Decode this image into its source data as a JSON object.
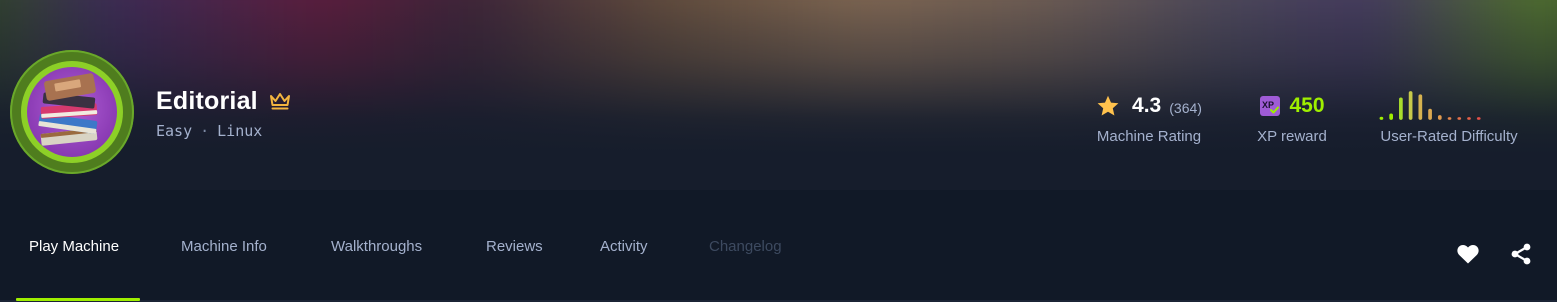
{
  "machine": {
    "name": "Editorial",
    "difficulty": "Easy",
    "separator": "·",
    "os": "Linux",
    "avatar_icon": "book-stack-icon",
    "badge_icon": "crown-icon"
  },
  "stats": {
    "rating": {
      "icon": "star-icon",
      "value": "4.3",
      "count": "(364)",
      "label": "Machine Rating"
    },
    "xp": {
      "icon": "xp-icon",
      "value": "450",
      "label": "XP reward"
    },
    "difficulty": {
      "label": "User-Rated Difficulty",
      "distribution": [
        2,
        4,
        14,
        18,
        16,
        7,
        3,
        1,
        1,
        1,
        1
      ]
    }
  },
  "tabs": [
    {
      "label": "Play Machine",
      "state": "active"
    },
    {
      "label": "Machine Info",
      "state": "normal"
    },
    {
      "label": "Walkthroughs",
      "state": "normal"
    },
    {
      "label": "Reviews",
      "state": "normal"
    },
    {
      "label": "Activity",
      "state": "normal"
    },
    {
      "label": "Changelog",
      "state": "disabled"
    }
  ],
  "actions": {
    "favorite_icon": "heart-icon",
    "share_icon": "share-icon"
  },
  "colors": {
    "accent": "#9fef00",
    "background": "#111927",
    "star": "#ffc24d",
    "xp_badge": "#9f5bd6",
    "muted_text": "#a4b1cd",
    "disabled_text": "#3d4a60"
  }
}
